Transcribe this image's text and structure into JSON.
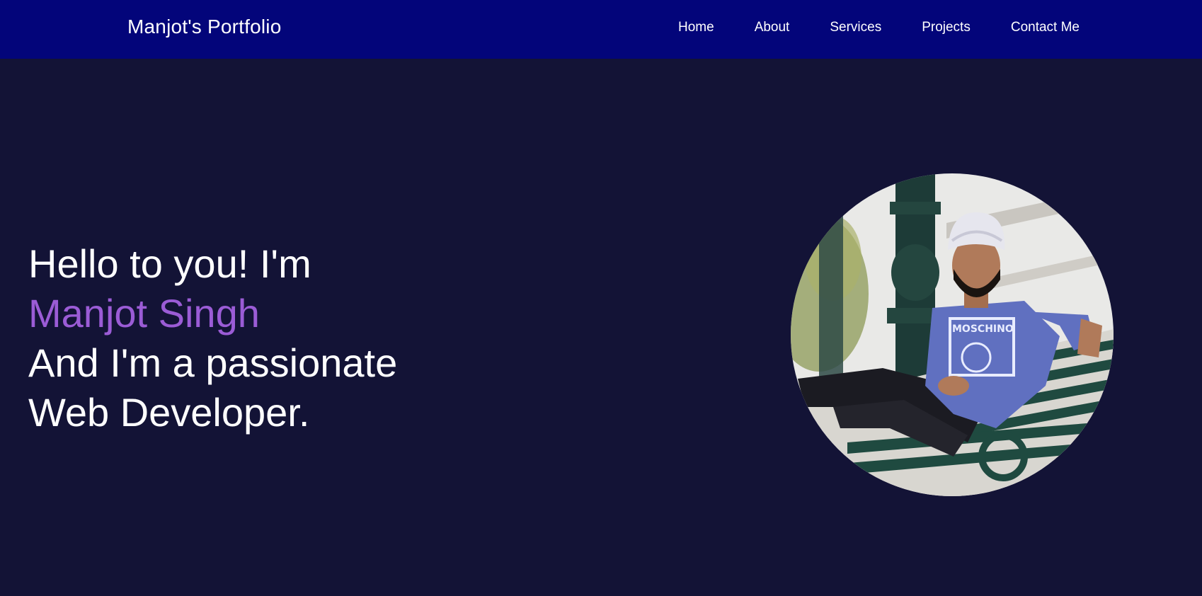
{
  "navbar": {
    "brand": "Manjot's Portfolio",
    "links": [
      {
        "label": "Home"
      },
      {
        "label": "About"
      },
      {
        "label": "Services"
      },
      {
        "label": "Projects"
      },
      {
        "label": "Contact Me"
      }
    ]
  },
  "hero": {
    "greeting": "Hello to you! I'm",
    "name": "Manjot Singh",
    "line3": "And I'm a passionate",
    "line4": "Web Developer."
  },
  "portrait": {
    "shirt_text": "MOSCHINO"
  },
  "colors": {
    "navbar_bg": "#03057a",
    "page_bg": "#131336",
    "accent": "#9b5cd6",
    "text": "#ffffff"
  }
}
